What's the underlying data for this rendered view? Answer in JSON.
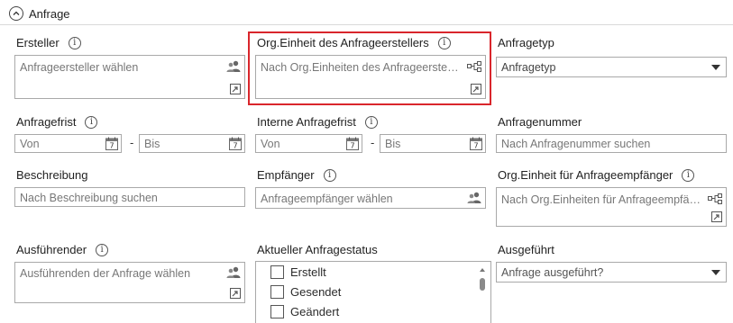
{
  "section": {
    "title": "Anfrage"
  },
  "fields": {
    "ersteller": {
      "label": "Ersteller",
      "placeholder": "Anfrageersteller wählen"
    },
    "org_ersteller": {
      "label": "Org.Einheit des Anfrageerstellers",
      "placeholder": "Nach Org.Einheiten des Anfrageersteller..."
    },
    "anfragetyp": {
      "label": "Anfragetyp",
      "value": "Anfragetyp"
    },
    "anfragefrist": {
      "label": "Anfragefrist",
      "from": "Von",
      "to": "Bis",
      "dash": "-"
    },
    "interne_frist": {
      "label": "Interne Anfragefrist",
      "from": "Von",
      "to": "Bis",
      "dash": "-"
    },
    "anfragenummer": {
      "label": "Anfragenummer",
      "placeholder": "Nach Anfragenummer suchen"
    },
    "beschreibung": {
      "label": "Beschreibung",
      "placeholder": "Nach Beschreibung suchen"
    },
    "empfaenger": {
      "label": "Empfänger",
      "placeholder": "Anfrageempfänger wählen"
    },
    "org_empfaenger": {
      "label": "Org.Einheit für Anfrageempfänger",
      "placeholder": "Nach Org.Einheiten für Anfrageempfäng..."
    },
    "ausfuehrender": {
      "label": "Ausführender",
      "placeholder": "Ausführenden der Anfrage wählen"
    },
    "status": {
      "label": "Aktueller Anfragestatus",
      "options": [
        "Erstellt",
        "Gesendet",
        "Geändert"
      ]
    },
    "ausgefuehrt": {
      "label": "Ausgeführt",
      "value": "Anfrage ausgeführt?"
    }
  },
  "icons": {
    "info": "info-icon",
    "user": "user-group-icon",
    "expand": "expand-icon",
    "calendar": "calendar-icon",
    "org": "org-tree-icon",
    "dropdown": "chevron-down-icon"
  },
  "colors": {
    "highlight": "#d9262c",
    "border": "#a9a9a9",
    "placeholder": "#777777"
  },
  "calendar_day": "7"
}
